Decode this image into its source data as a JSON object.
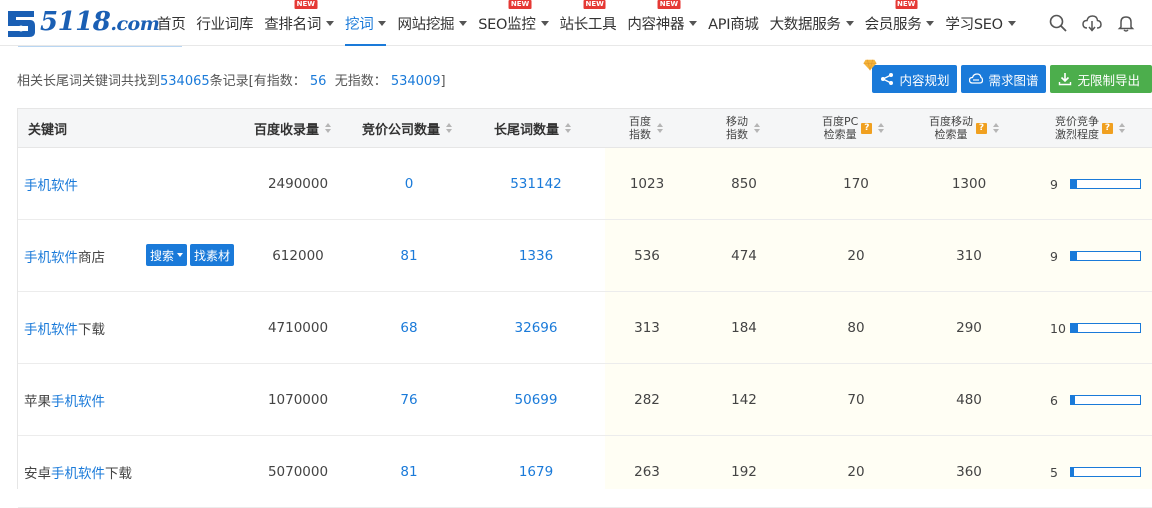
{
  "brand": {
    "logo_main": "5118",
    "logo_suffix": ".com"
  },
  "nav": [
    {
      "label": "首页",
      "caret": false,
      "new": false
    },
    {
      "label": "行业词库",
      "caret": false,
      "new": false
    },
    {
      "label": "查排名词",
      "caret": true,
      "new": true
    },
    {
      "label": "挖词",
      "caret": true,
      "new": false,
      "active": true
    },
    {
      "label": "网站挖掘",
      "caret": true,
      "new": false
    },
    {
      "label": "SEO监控",
      "caret": true,
      "new": true
    },
    {
      "label": "站长工具",
      "caret": false,
      "new": true
    },
    {
      "label": "内容神器",
      "caret": true,
      "new": true
    },
    {
      "label": "API商城",
      "caret": false,
      "new": false
    },
    {
      "label": "大数据服务",
      "caret": true,
      "new": false
    },
    {
      "label": "会员服务",
      "caret": true,
      "new": true
    },
    {
      "label": "学习SEO",
      "caret": true,
      "new": false
    }
  ],
  "new_badge": "NEW",
  "summary": {
    "prefix": "相关长尾词关键词共找到",
    "total": "534065",
    "mid": "条记录[有指数：",
    "with_index": "56",
    "no_index_label": "无指数：",
    "no_index": "534009",
    "suffix": "]"
  },
  "actions": {
    "content_plan": "内容规划",
    "demand_map": "需求图谱",
    "export": "无限制导出"
  },
  "columns": {
    "keyword": "关键词",
    "baidu_included": "百度收录量",
    "bid_companies": "竞价公司数量",
    "longtail": "长尾词数量",
    "baidu_index_1": "百度",
    "baidu_index_2": "指数",
    "mobile_index_1": "移动",
    "mobile_index_2": "指数",
    "pc_search_1": "百度PC",
    "pc_search_2": "检索量",
    "mobile_search_1": "百度移动",
    "mobile_search_2": "检索量",
    "competition_1": "竞价竞争",
    "competition_2": "激烈程度"
  },
  "row_buttons": {
    "search": "搜索",
    "material": "找素材"
  },
  "rows": [
    {
      "kw_pre": "",
      "kw_hit": "手机软件",
      "kw_post": "",
      "included": "2490000",
      "bid": "0",
      "longtail": "531142",
      "bidx": "1023",
      "midx": "850",
      "pc": "170",
      "mob": "1300",
      "comp": "9",
      "comp_level": 0.09
    },
    {
      "kw_pre": "",
      "kw_hit": "手机软件",
      "kw_post": "商店",
      "included": "612000",
      "bid": "81",
      "longtail": "1336",
      "bidx": "536",
      "midx": "474",
      "pc": "20",
      "mob": "310",
      "comp": "9",
      "comp_level": 0.09
    },
    {
      "kw_pre": "",
      "kw_hit": "手机软件",
      "kw_post": "下载",
      "included": "4710000",
      "bid": "68",
      "longtail": "32696",
      "bidx": "313",
      "midx": "184",
      "pc": "80",
      "mob": "290",
      "comp": "10",
      "comp_level": 0.1
    },
    {
      "kw_pre": "苹果",
      "kw_hit": "手机软件",
      "kw_post": "",
      "included": "1070000",
      "bid": "76",
      "longtail": "50699",
      "bidx": "282",
      "midx": "142",
      "pc": "70",
      "mob": "480",
      "comp": "6",
      "comp_level": 0.06
    },
    {
      "kw_pre": "安卓",
      "kw_hit": "手机软件",
      "kw_post": "下载",
      "included": "5070000",
      "bid": "81",
      "longtail": "1679",
      "bidx": "263",
      "midx": "192",
      "pc": "20",
      "mob": "360",
      "comp": "5",
      "comp_level": 0.05
    }
  ],
  "colors": {
    "accent": "#1a7ad9",
    "green": "#4cae4c",
    "new": "#e53935",
    "help": "#f0a020"
  }
}
